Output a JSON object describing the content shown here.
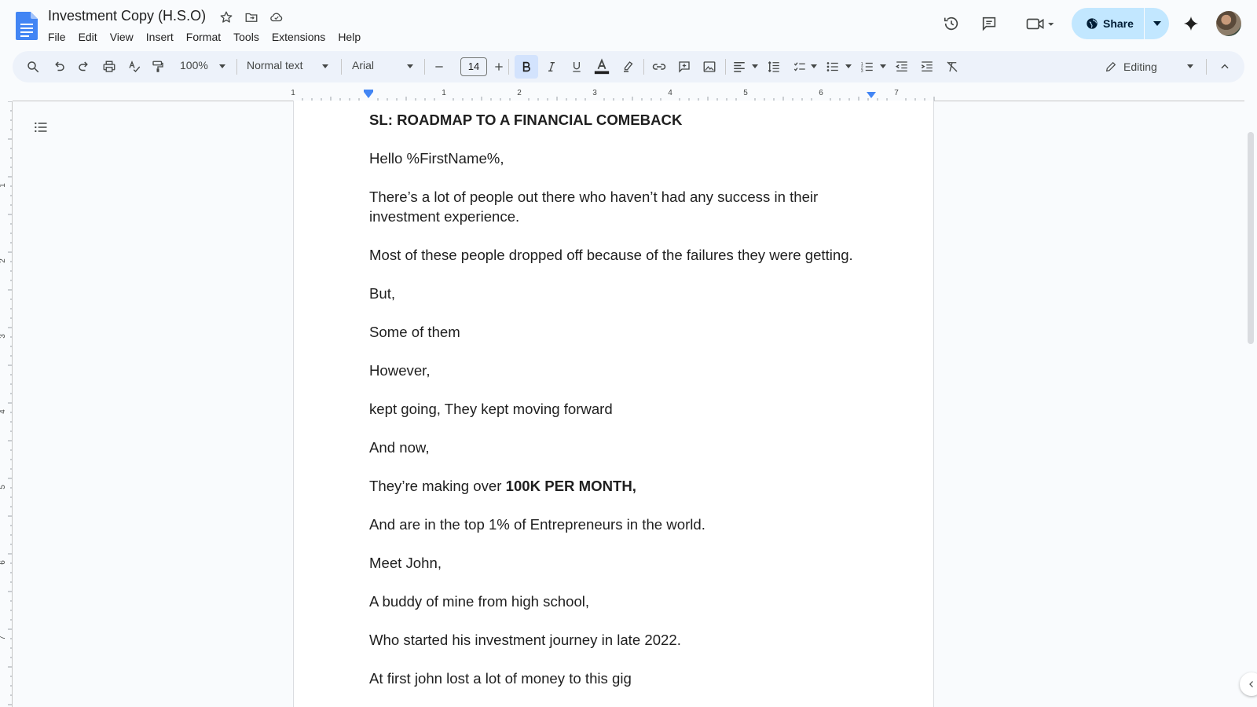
{
  "app": {
    "title": "Investment Copy (H.S.O)",
    "menus": [
      "File",
      "Edit",
      "View",
      "Insert",
      "Format",
      "Tools",
      "Extensions",
      "Help"
    ],
    "share_label": "Share",
    "accent_color": "#c2e7ff"
  },
  "toolbar": {
    "zoom": "100%",
    "style": "Normal text",
    "font": "Arial",
    "font_size": "14",
    "mode": "Editing"
  },
  "ruler": {
    "labels": [
      "1",
      "1",
      "2",
      "3",
      "4",
      "5",
      "6",
      "7"
    ],
    "v_labels": [
      "1",
      "2",
      "3",
      "4",
      "5",
      "6",
      "7"
    ]
  },
  "document": {
    "paragraphs": [
      {
        "text": "SL: ROADMAP TO A FINANCIAL COMEBACK",
        "bold": true
      },
      {
        "text": "Hello %FirstName%,"
      },
      {
        "text": "There’s a lot of people out there who haven’t had any success in their investment experience."
      },
      {
        "text": "Most of these people dropped off because of the failures they were getting."
      },
      {
        "text": "But,"
      },
      {
        "text": "Some of them"
      },
      {
        "text": "However,"
      },
      {
        "text": "kept going, They kept moving forward"
      },
      {
        "text": "And now,"
      },
      {
        "text": "They’re making over ",
        "bold_suffix": "100K PER MONTH,"
      },
      {
        "text": " And are in the top 1% of Entrepreneurs in the world."
      },
      {
        "text": "Meet John,"
      },
      {
        "text": "A buddy of mine from high school,"
      },
      {
        "text": "Who started his investment journey in late 2022."
      },
      {
        "text": "At first john lost a lot of money to this gig"
      }
    ]
  }
}
